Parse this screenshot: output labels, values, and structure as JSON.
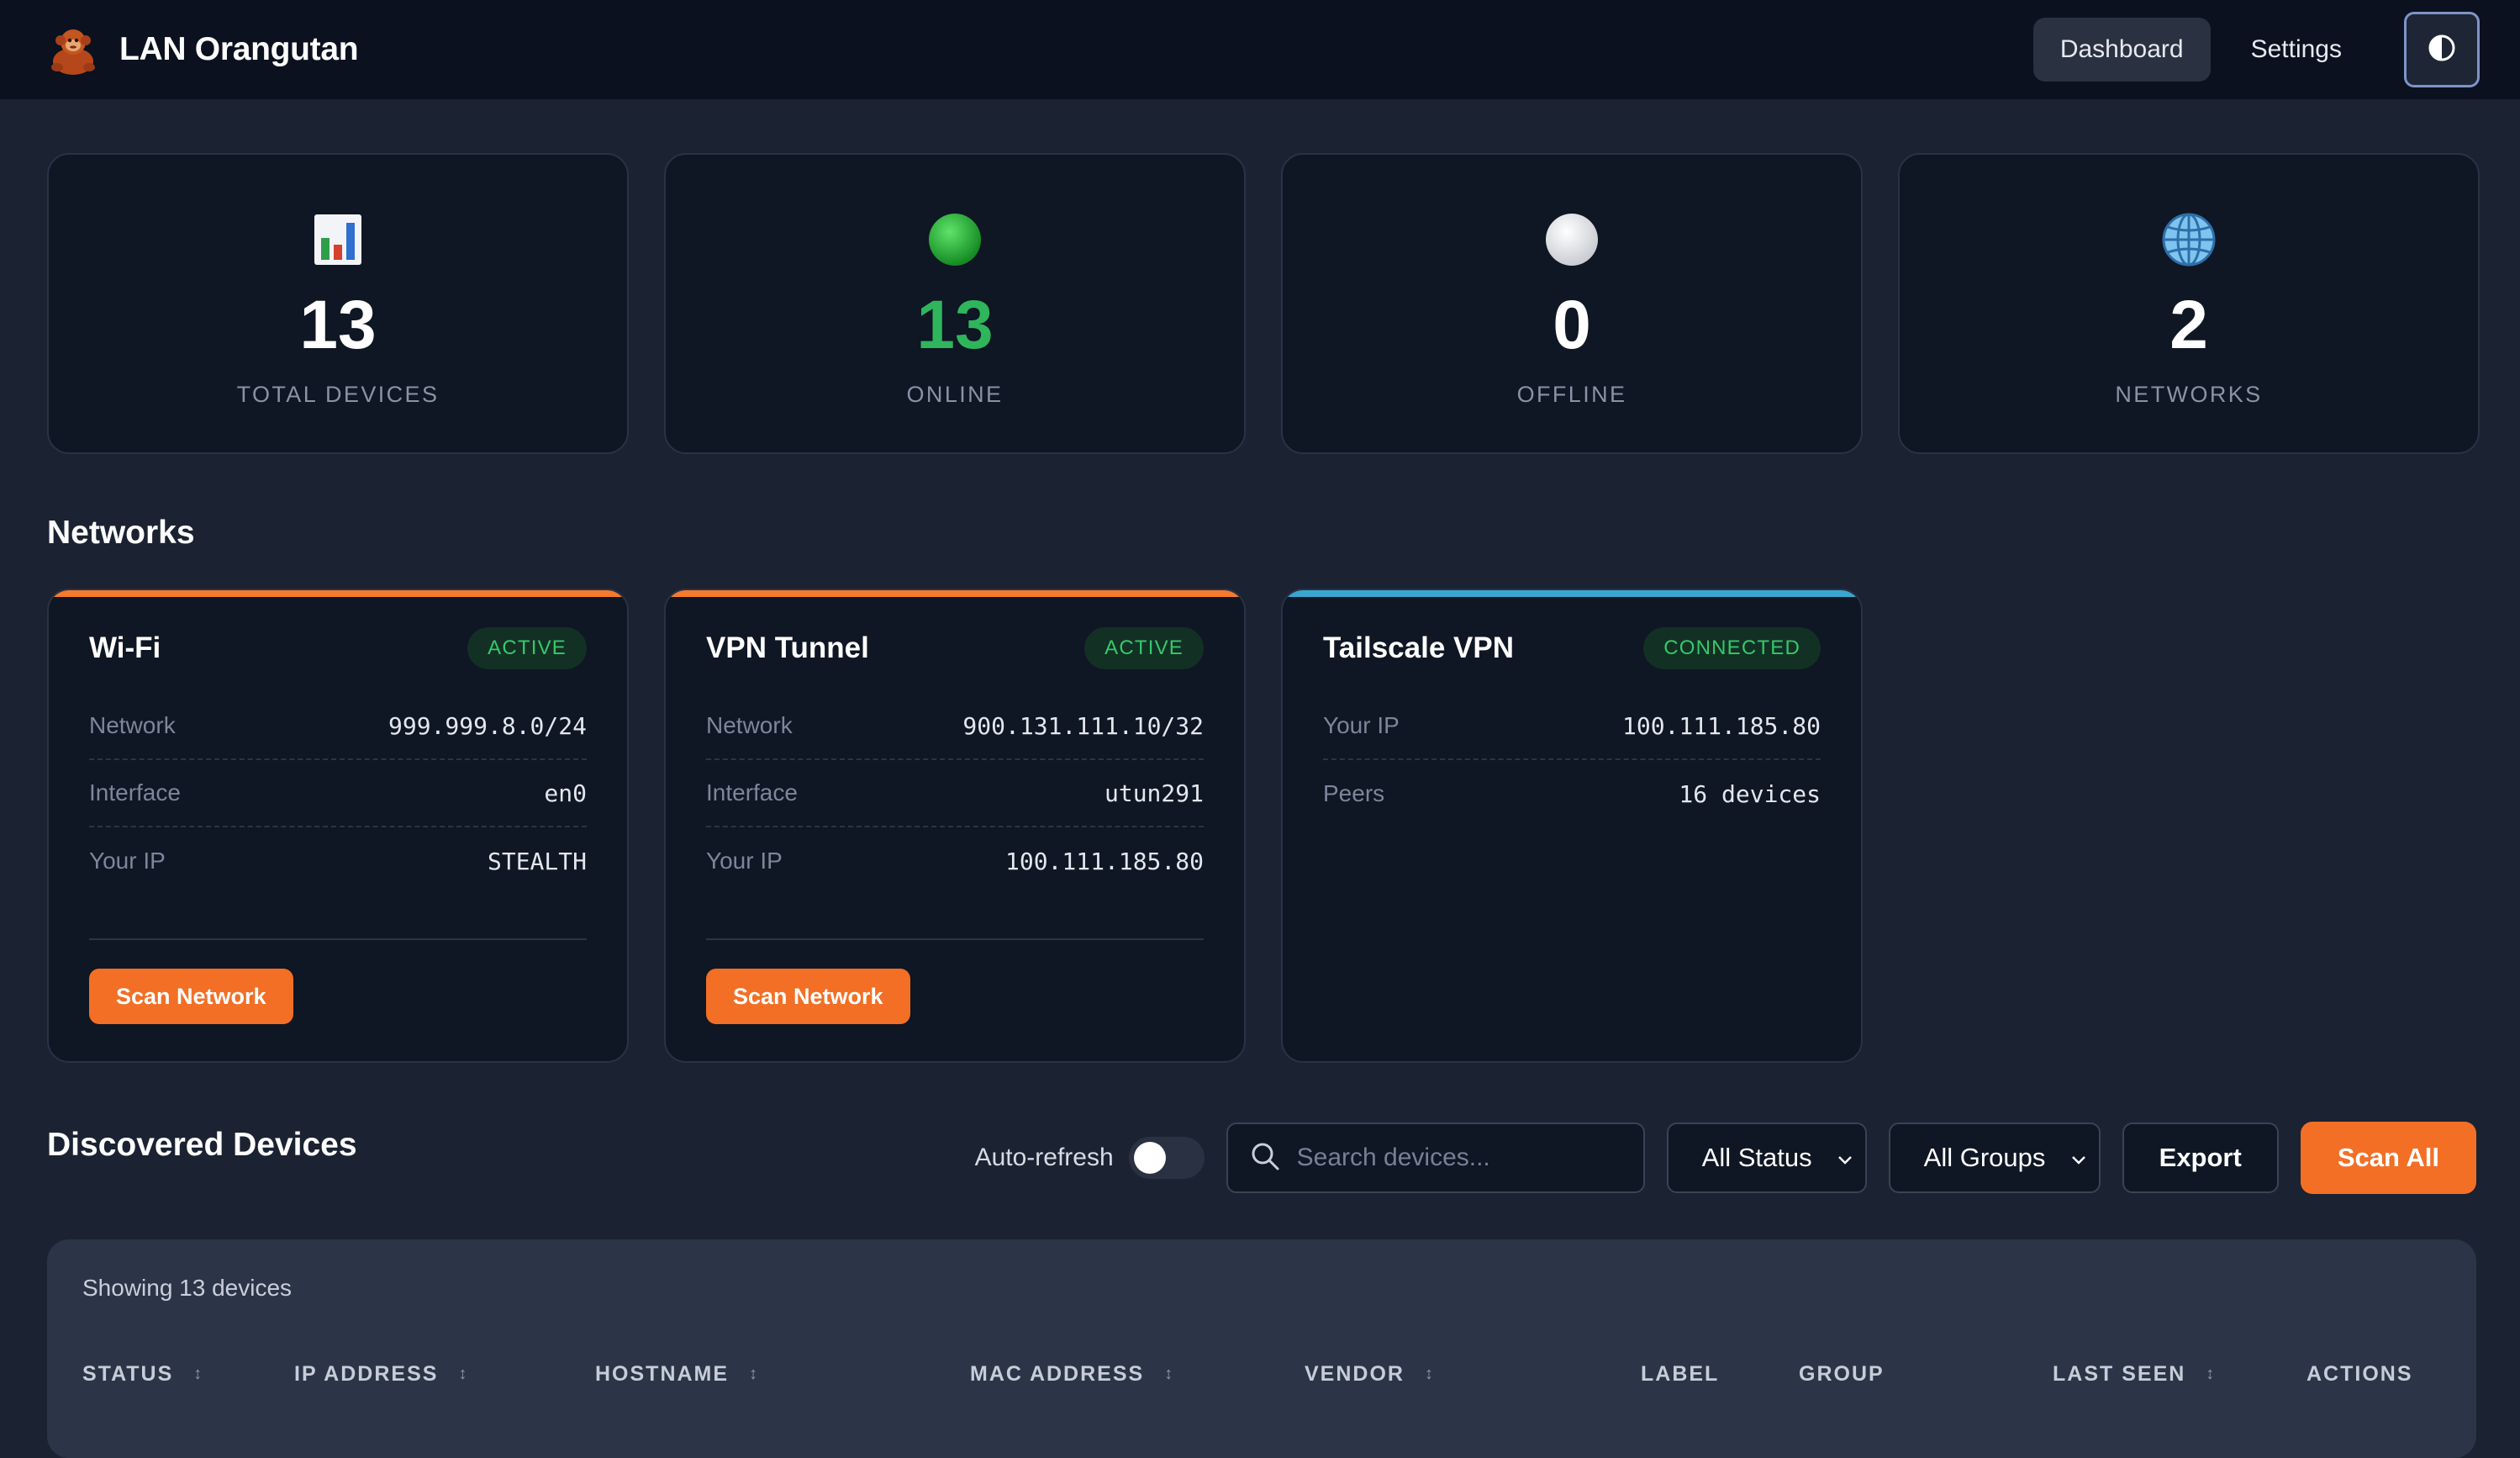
{
  "app": {
    "name": "LAN Orangutan"
  },
  "nav": {
    "dashboard": "Dashboard",
    "settings": "Settings",
    "theme_icon": "contrast-icon"
  },
  "stats": [
    {
      "icon": "bar-chart-icon",
      "value": "13",
      "label": "TOTAL DEVICES"
    },
    {
      "icon": "green-circle-icon",
      "value": "13",
      "label": "ONLINE",
      "color": "#2fb55b"
    },
    {
      "icon": "white-circle-icon",
      "value": "0",
      "label": "OFFLINE"
    },
    {
      "icon": "globe-icon",
      "value": "2",
      "label": "NETWORKS"
    }
  ],
  "networks_title": "Networks",
  "networks": [
    {
      "name": "Wi-Fi",
      "badge": "ACTIVE",
      "accent": "#f47a2e",
      "rows": [
        {
          "k": "Network",
          "v": "999.999.8.0/24"
        },
        {
          "k": "Interface",
          "v": "en0"
        },
        {
          "k": "Your IP",
          "v": "STEALTH"
        }
      ],
      "button": "Scan Network"
    },
    {
      "name": "VPN Tunnel",
      "badge": "ACTIVE",
      "accent": "#f47a2e",
      "rows": [
        {
          "k": "Network",
          "v": "900.131.111.10/32"
        },
        {
          "k": "Interface",
          "v": "utun291"
        },
        {
          "k": "Your IP",
          "v": "100.111.185.80"
        }
      ],
      "button": "Scan Network"
    },
    {
      "name": "Tailscale VPN",
      "badge": "CONNECTED",
      "accent": "#3aa6d0",
      "rows": [
        {
          "k": "Your IP",
          "v": "100.111.185.80"
        },
        {
          "k": "Peers",
          "v": "16 devices"
        }
      ]
    }
  ],
  "devices_title": "Discovered Devices",
  "toolbar": {
    "auto_refresh": "Auto-refresh",
    "auto_refresh_on": false,
    "search_placeholder": "Search devices...",
    "status_filter": "All Status",
    "group_filter": "All Groups",
    "export": "Export",
    "scan_all": "Scan All"
  },
  "table": {
    "showing": "Showing 13 devices",
    "columns": [
      "STATUS",
      "IP ADDRESS",
      "HOSTNAME",
      "MAC ADDRESS",
      "VENDOR",
      "LABEL",
      "GROUP",
      "LAST SEEN",
      "ACTIONS"
    ]
  },
  "colors": {
    "accent": "#f26f25",
    "online": "#2fb55b",
    "header_bg": "#0b111e",
    "page_bg": "#1b2232"
  }
}
